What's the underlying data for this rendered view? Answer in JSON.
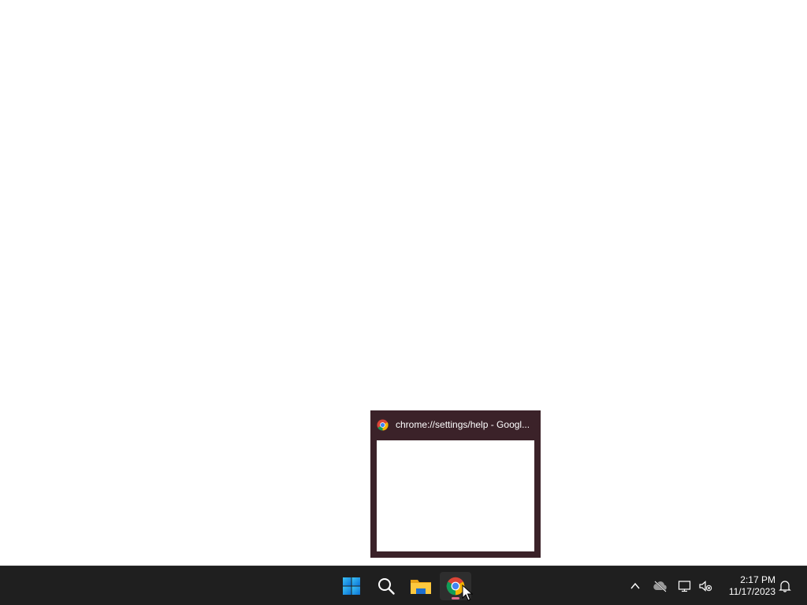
{
  "preview": {
    "title": "chrome://settings/help - Googl...",
    "app_icon": "chrome-icon"
  },
  "taskbar": {
    "items": [
      {
        "name": "start",
        "icon": "windows-logo-icon"
      },
      {
        "name": "search",
        "icon": "search-icon"
      },
      {
        "name": "file-explorer",
        "icon": "folder-icon"
      },
      {
        "name": "chrome",
        "icon": "chrome-icon",
        "active": true
      }
    ],
    "tray": {
      "icons": [
        "chevron-up-icon",
        "cloud-offline-icon",
        "network-icon",
        "volume-muted-icon",
        "notification-bell-icon"
      ],
      "time": "2:17 PM",
      "date": "11/17/2023"
    }
  },
  "colors": {
    "taskbar_bg": "#1f1f1f",
    "preview_bg": "#3b2229",
    "accent": "#e06c8a"
  }
}
